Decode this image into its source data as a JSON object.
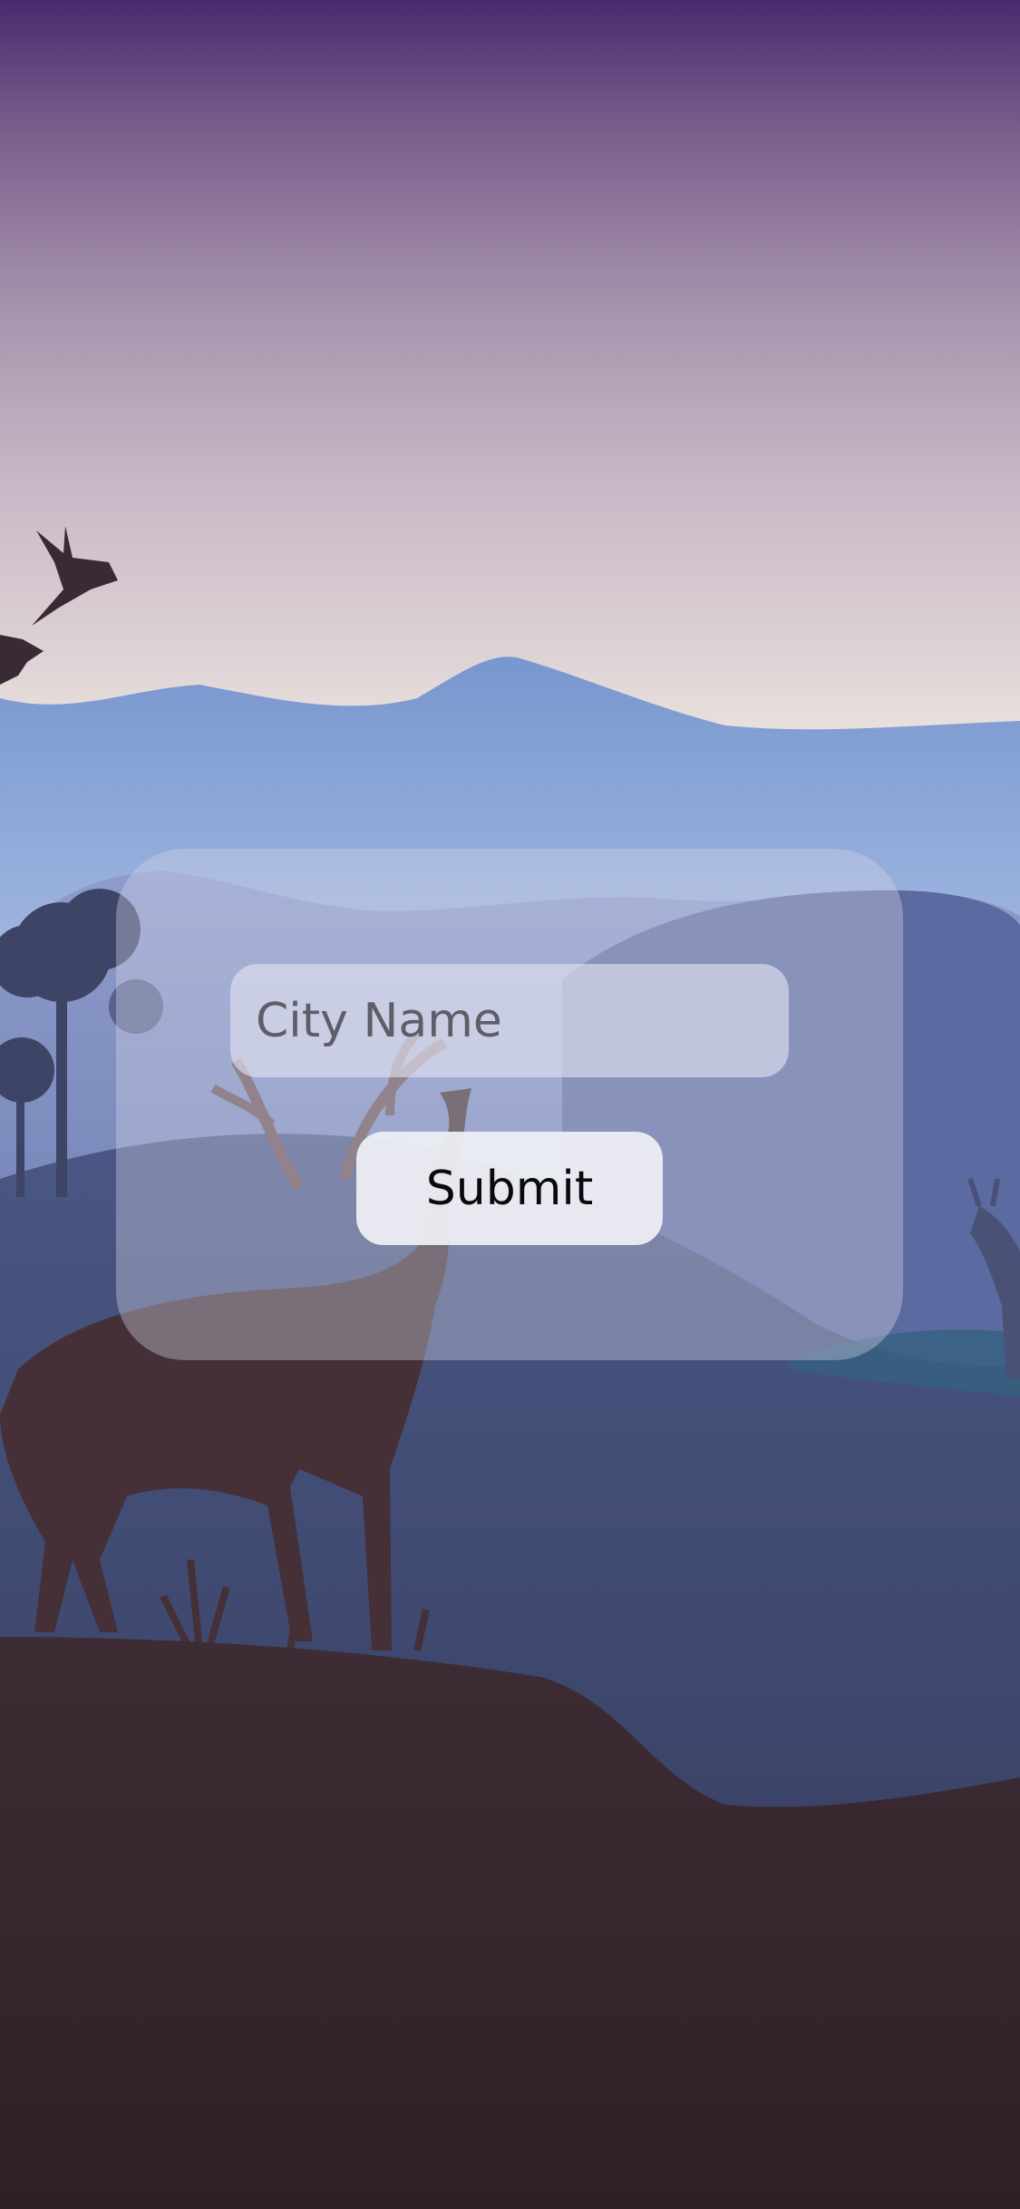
{
  "city_form": {
    "input_placeholder": "City Name",
    "input_value": "",
    "submit_label": "Submit"
  },
  "background": {
    "scene": "mountain-deer-landscape",
    "colors": {
      "sky_top": "#4a2a6e",
      "sky_bottom": "#e8e0dc",
      "mountain_far": "#7b9bd1",
      "mountain_mid": "#5a6aa3",
      "valley": "#3e4a6c",
      "ground": "#3a2a30"
    }
  }
}
